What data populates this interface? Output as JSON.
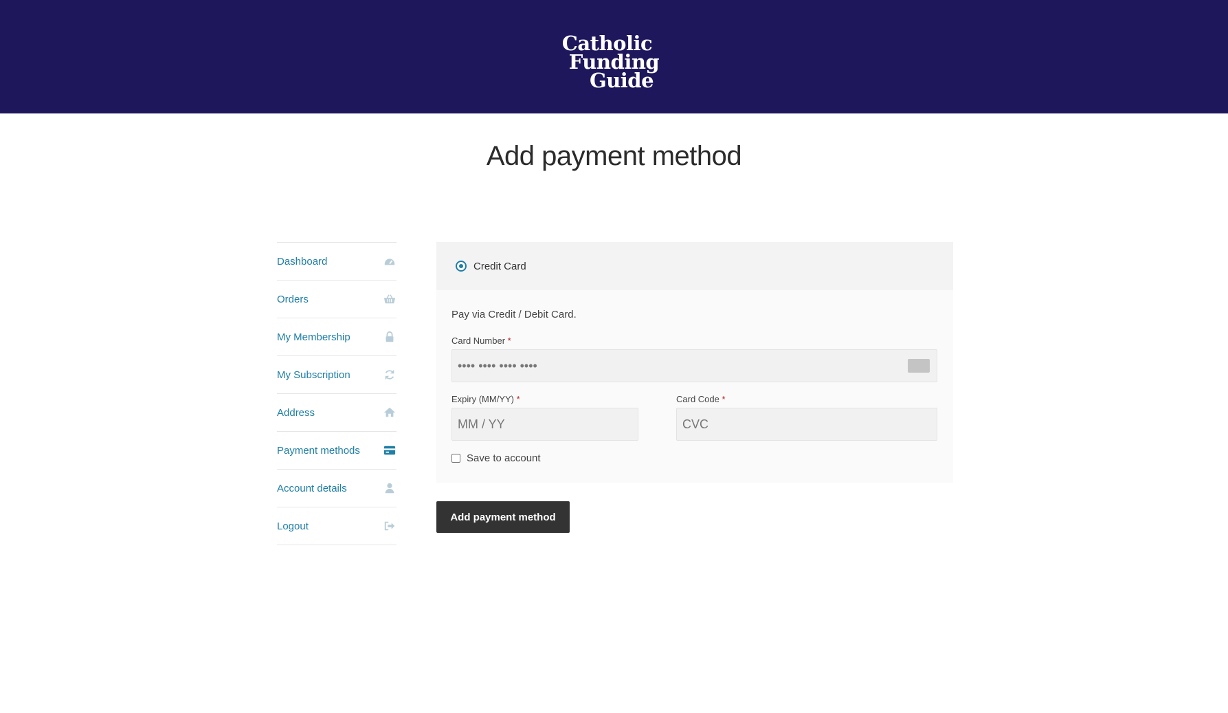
{
  "header": {
    "logo_line1": "Catholic",
    "logo_line2": "Funding",
    "logo_line3": "Guide",
    "background": "#1e175c"
  },
  "page_title": "Add payment method",
  "sidebar": {
    "items": [
      {
        "label": "Dashboard",
        "icon": "dashboard-icon",
        "active": false
      },
      {
        "label": "Orders",
        "icon": "basket-icon",
        "active": false
      },
      {
        "label": "My Membership",
        "icon": "lock-icon",
        "active": false
      },
      {
        "label": "My Subscription",
        "icon": "refresh-icon",
        "active": false
      },
      {
        "label": "Address",
        "icon": "home-icon",
        "active": false
      },
      {
        "label": "Payment methods",
        "icon": "credit-card-icon",
        "active": true
      },
      {
        "label": "Account details",
        "icon": "user-icon",
        "active": false
      },
      {
        "label": "Logout",
        "icon": "logout-icon",
        "active": false
      }
    ],
    "link_color": "#1f7ea6"
  },
  "payment": {
    "method_label": "Credit Card",
    "description": "Pay via Credit / Debit Card.",
    "card_number_label": "Card Number",
    "card_number_placeholder": "•••• •••• •••• ••••",
    "expiry_label": "Expiry (MM/YY)",
    "expiry_placeholder": "MM / YY",
    "card_code_label": "Card Code",
    "card_code_placeholder": "CVC",
    "required_mark": "*",
    "save_label": "Save to account"
  },
  "submit_label": "Add payment method"
}
